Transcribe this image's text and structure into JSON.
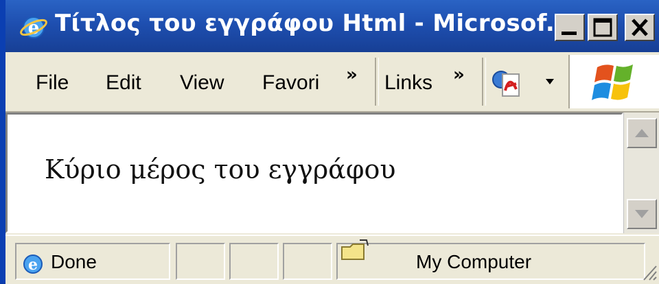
{
  "window": {
    "title": "Τίτλος του εγγράφου Html - Microsof...",
    "minimize": "minimize",
    "maximize": "maximize",
    "close": "close"
  },
  "menubar": {
    "items": [
      "File",
      "Edit",
      "View",
      "Favori"
    ],
    "more_chevron": "»",
    "links_label": "Links",
    "links_chevron": "»"
  },
  "document": {
    "body_text": "Κύριο μέρος του εγγράφου"
  },
  "statusbar": {
    "status": "Done",
    "zone": "My Computer"
  },
  "colors": {
    "titlebar": "#1e4fb0",
    "chrome": "#ece9d8",
    "content": "#ffffff"
  }
}
